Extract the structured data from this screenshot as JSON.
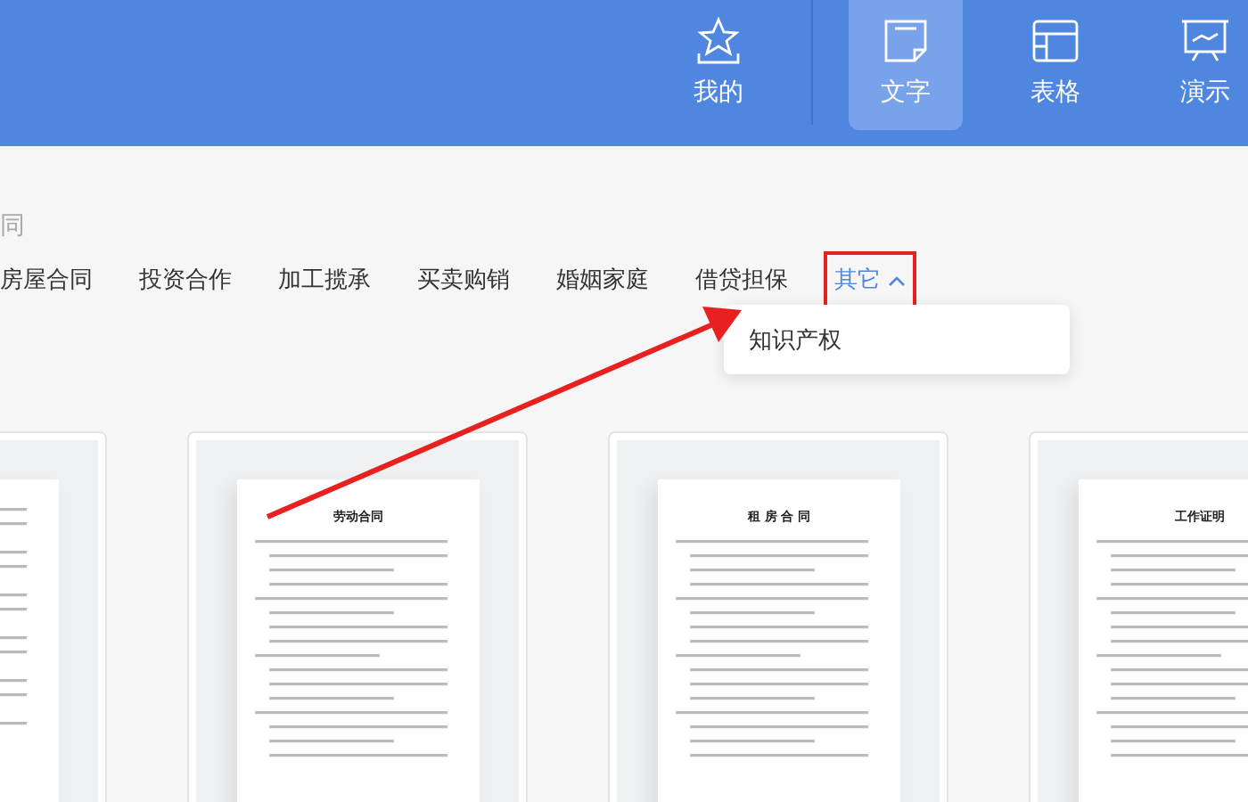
{
  "nav": [
    {
      "label": "我的",
      "kind": "star",
      "selected": false
    },
    {
      "label": "文字",
      "kind": "note",
      "selected": true
    },
    {
      "label": "表格",
      "kind": "table",
      "selected": false
    },
    {
      "label": "演示",
      "kind": "board",
      "selected": false
    }
  ],
  "section_title": "同",
  "categories": [
    {
      "label": "房屋合同",
      "kind": "link",
      "selected": false
    },
    {
      "label": "投资合作",
      "kind": "link",
      "selected": false
    },
    {
      "label": "加工揽承",
      "kind": "link",
      "selected": false
    },
    {
      "label": "买卖购销",
      "kind": "link",
      "selected": false
    },
    {
      "label": "婚姻家庭",
      "kind": "link",
      "selected": false
    },
    {
      "label": "借贷担保",
      "kind": "link",
      "selected": false
    },
    {
      "label": "其它",
      "kind": "dropdown",
      "selected": true,
      "expanded": true,
      "highlighted": true
    }
  ],
  "dropdown": {
    "items": [
      "知识产权"
    ]
  },
  "templates": [
    {
      "kind": "partial"
    },
    {
      "kind": "document",
      "title": "劳动合同"
    },
    {
      "kind": "document",
      "title": "租 房 合 同"
    },
    {
      "kind": "document",
      "title": "工作证明"
    }
  ]
}
